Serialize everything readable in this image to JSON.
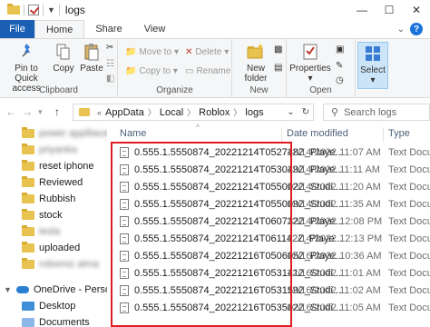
{
  "window": {
    "title": "logs"
  },
  "ribbon_tabs": [
    "File",
    "Home",
    "Share",
    "View"
  ],
  "ribbon": {
    "clipboard": {
      "pin_label": "Pin to Quick access",
      "copy_label": "Copy",
      "paste_label": "Paste",
      "group_label": "Clipboard"
    },
    "organize": {
      "move_to_label": "Move to",
      "copy_to_label": "Copy to",
      "delete_label": "Delete",
      "rename_label": "Rename",
      "group_label": "Organize"
    },
    "new": {
      "new_folder_label": "New folder",
      "group_label": "New"
    },
    "open": {
      "properties_label": "Properties",
      "group_label": "Open"
    },
    "select": {
      "select_label": "Select"
    }
  },
  "address": {
    "crumbs": [
      "AppData",
      "Local",
      "Roblox",
      "logs"
    ]
  },
  "search": {
    "placeholder": "Search logs"
  },
  "nav_pane": {
    "items": [
      {
        "label": "power applilaces",
        "blurred": true
      },
      {
        "label": "priyanka",
        "blurred": true
      },
      {
        "label": "reset iphone",
        "blurred": false
      },
      {
        "label": "Reviewed",
        "blurred": false
      },
      {
        "label": "Rubbish",
        "blurred": false
      },
      {
        "label": "stock",
        "blurred": false
      },
      {
        "label": "tesla",
        "blurred": true
      },
      {
        "label": "uploaded",
        "blurred": false
      },
      {
        "label": "robomiz alma",
        "blurred": true
      }
    ],
    "onedrive": "OneDrive - Person",
    "desktop": "Desktop",
    "documents": "Documents"
  },
  "columns": {
    "name": "Name",
    "date": "Date modified",
    "type": "Type"
  },
  "files": [
    {
      "name": "0.555.1.5550874_20221214T052748Z_Playe...",
      "date": "12/14/2022 11:07 AM",
      "type": "Text Docum"
    },
    {
      "name": "0.555.1.5550874_20221214T053049Z_Playe...",
      "date": "12/14/2022 11:11 AM",
      "type": "Text Docum"
    },
    {
      "name": "0.555.1.5550874_20221214T055002Z_Studi...",
      "date": "12/14/2022 11:20 AM",
      "type": "Text Docum"
    },
    {
      "name": "0.555.1.5550874_20221214T055009Z_Studi...",
      "date": "12/14/2022 11:35 AM",
      "type": "Text Docum"
    },
    {
      "name": "0.555.1.5550874_20221214T060732Z_Playe...",
      "date": "12/14/2022 12:08 PM",
      "type": "Text Docum"
    },
    {
      "name": "0.555.1.5550874_20221214T061142Z_Playe...",
      "date": "12/14/2022 12:13 PM",
      "type": "Text Docum"
    },
    {
      "name": "0.555.1.5550874_20221216T050605Z_Playe...",
      "date": "12/16/2022 10:36 AM",
      "type": "Text Docum"
    },
    {
      "name": "0.555.1.5550874_20221216T053141Z_Studi...",
      "date": "12/16/2022 11:01 AM",
      "type": "Text Docum"
    },
    {
      "name": "0.555.1.5550874_20221216T053159Z_Studi...",
      "date": "12/16/2022 11:02 AM",
      "type": "Text Docum"
    },
    {
      "name": "0.555.1.5550874_20221216T053502Z_Studi...",
      "date": "12/16/2022 11:05 AM",
      "type": "Text Docum"
    }
  ],
  "colors": {
    "file_tab": "#1a5fb4",
    "highlight_border": "#e01b24",
    "folder": "#e8c350"
  }
}
